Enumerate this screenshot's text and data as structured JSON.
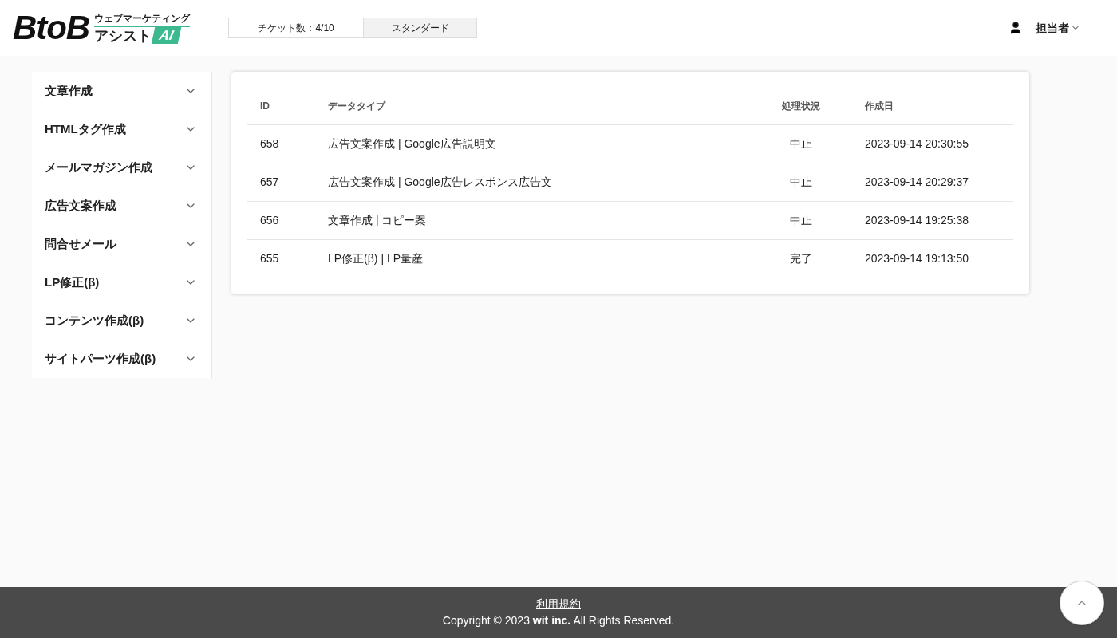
{
  "header": {
    "logo": {
      "main": "BtoB",
      "sub": "ウェブマーケティング",
      "name": "アシスト",
      "badge": "AI"
    },
    "ticket": "チケット数：4/10",
    "plan": "スタンダード",
    "user": "担当者"
  },
  "sidebar": {
    "items": [
      {
        "label": "文章作成",
        "expanded": false
      },
      {
        "label": "HTMLタグ作成",
        "expanded": false
      },
      {
        "label": "メールマガジン作成",
        "expanded": false
      },
      {
        "label": "広告文案作成",
        "expanded": false
      },
      {
        "label": "問合せメール",
        "expanded": false
      },
      {
        "label": "LP修正(β)",
        "expanded": false
      },
      {
        "label": "コンテンツ作成(β)",
        "expanded": false
      },
      {
        "label": "サイトパーツ作成(β)",
        "expanded": false
      }
    ]
  },
  "table": {
    "columns": [
      "ID",
      "データタイプ",
      "処理状況",
      "作成日"
    ],
    "rows": [
      [
        "658",
        "広告文案作成 | Google広告説明文",
        "中止",
        "2023-09-14 20:30:55"
      ],
      [
        "657",
        "広告文案作成 | Google広告レスポンス広告文",
        "中止",
        "2023-09-14 20:29:37"
      ],
      [
        "656",
        "文章作成 | コピー案",
        "中止",
        "2023-09-14 19:25:38"
      ],
      [
        "655",
        "LP修正(β) | LP量産",
        "完了",
        "2023-09-14 19:13:50"
      ]
    ]
  },
  "footer": {
    "link": "利用規約",
    "copyright": "Copyright © 2023 **wit inc.** All Rights Reserved."
  }
}
